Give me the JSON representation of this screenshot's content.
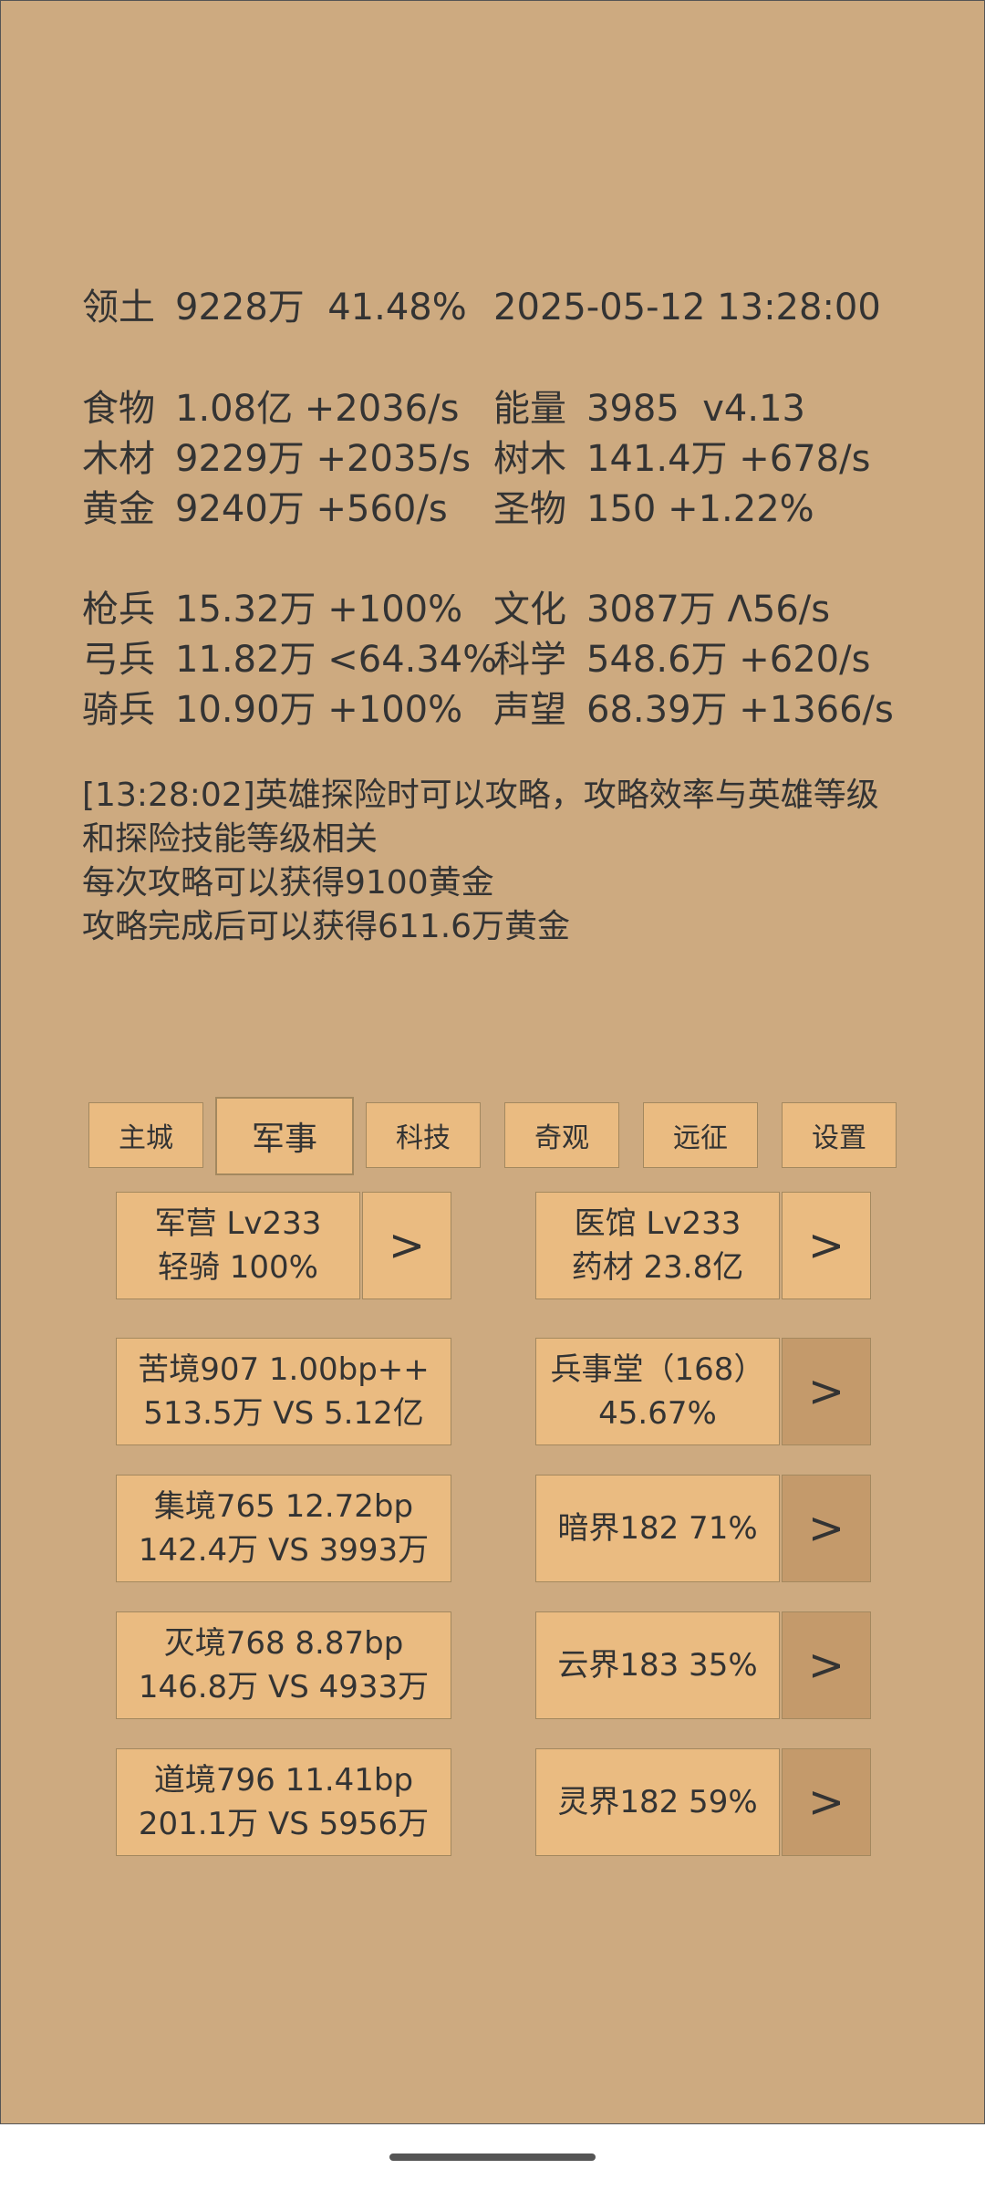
{
  "header": {
    "territory_label": "领土",
    "territory_value": "9228万  41.48%",
    "datetime": "2025-05-12 13:28:00"
  },
  "resources": [
    {
      "label": "食物",
      "value": "1.08亿 +2036/s"
    },
    {
      "label": "木材",
      "value": "9229万 +2035/s"
    },
    {
      "label": "黄金",
      "value": "9240万 +560/s"
    },
    {
      "label": "能量",
      "value": "3985  v4.13"
    },
    {
      "label": "树木",
      "value": "141.4万 +678/s"
    },
    {
      "label": "圣物",
      "value": "150 +1.22%"
    }
  ],
  "troops": [
    {
      "label": "枪兵",
      "value": "15.32万 +100%"
    },
    {
      "label": "弓兵",
      "value": "11.82万 <64.34%"
    },
    {
      "label": "骑兵",
      "value": "10.90万 +100%"
    },
    {
      "label": "文化",
      "value": "3087万 Λ56/s"
    },
    {
      "label": "科学",
      "value": "548.6万 +620/s"
    },
    {
      "label": "声望",
      "value": "68.39万 +1366/s"
    }
  ],
  "log": [
    "[13:28:02]英雄探险时可以攻略，攻略效率与英雄等级和探险技能等级相关",
    "每次攻略可以获得9100黄金",
    "攻略完成后可以获得611.6万黄金"
  ],
  "tabs": [
    "主城",
    "军事",
    "科技",
    "奇观",
    "远征",
    "设置"
  ],
  "active_tab": "军事",
  "buildings": {
    "barracks": {
      "line1": "军营 Lv233",
      "line2": "轻骑 100%"
    },
    "hospital": {
      "line1": "医馆 Lv233",
      "line2": "药材 23.8亿"
    },
    "military_hall": {
      "line1": "兵事堂（168）",
      "line2": "45.67%"
    }
  },
  "realms": [
    {
      "line1": "苦境907  1.00bp++",
      "line2": "513.5万 VS 5.12亿"
    },
    {
      "line1": "集境765  12.72bp",
      "line2": "142.4万 VS 3993万"
    },
    {
      "line1": "灭境768  8.87bp",
      "line2": "146.8万 VS 4933万"
    },
    {
      "line1": "道境796  11.41bp",
      "line2": "201.1万 VS 5956万"
    }
  ],
  "worlds": [
    {
      "label": "暗界182  71%"
    },
    {
      "label": "云界183  35%"
    },
    {
      "label": "灵界182  59%"
    }
  ],
  "arrow_label": ">",
  "colors": {
    "background": "#cdaa80",
    "button": "#eabb81",
    "button_dark": "#c49a6b",
    "text": "#333333"
  }
}
